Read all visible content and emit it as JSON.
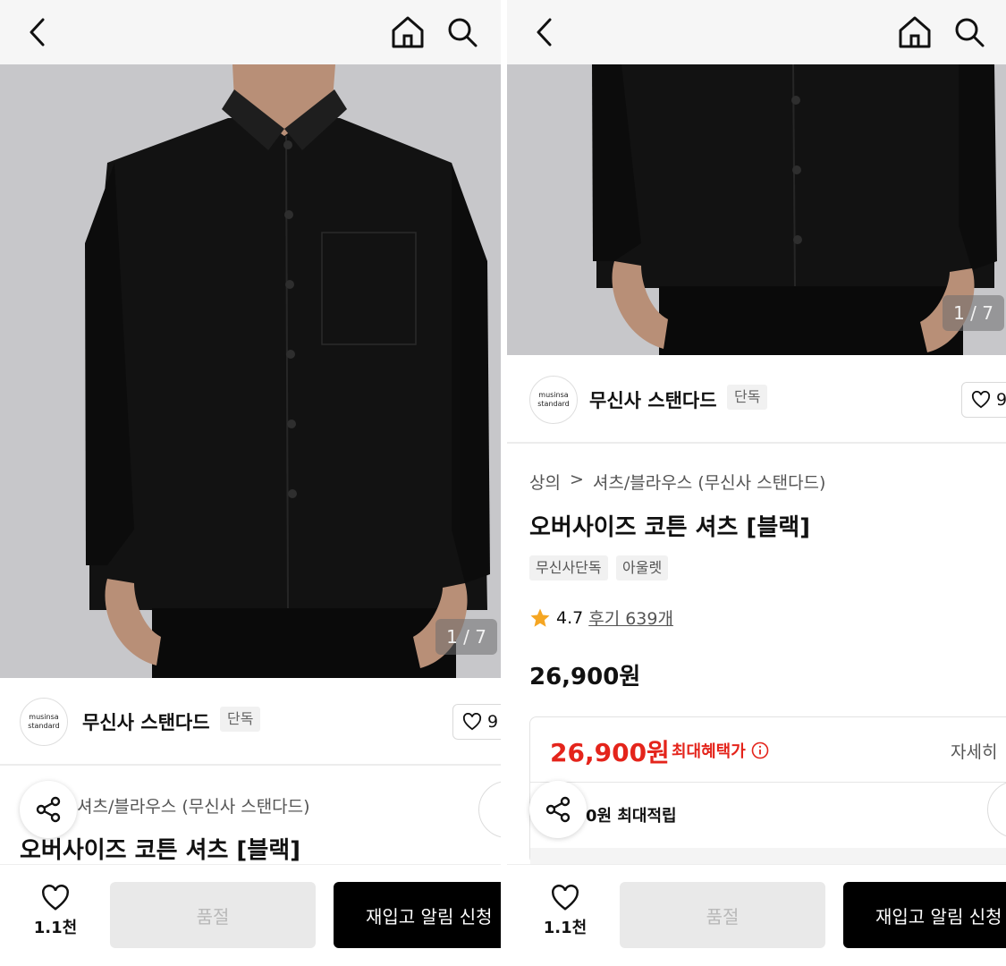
{
  "counter": "1 / 7",
  "brand": {
    "logo_line1": "musinsa",
    "logo_line2": "standard",
    "name": "무신사 스탠다드",
    "badge": "단독",
    "likes": "9"
  },
  "product": {
    "category_root": "상의",
    "category_sep": ">",
    "category_sub": "셔츠/블라우스 (무신사 스탠다드)",
    "category_sub_partial": "셔츠/블라우스 (무신사 스탠다드)",
    "title": "오버사이즈 코튼 셔츠 [블랙]",
    "tags": [
      "무신사단독",
      "아울렛"
    ],
    "rating": "4.7",
    "reviews": "후기 639개",
    "price": "26,900원"
  },
  "benefit": {
    "price": "26,900원",
    "label": "최대혜택가",
    "detail": "자세히",
    "points": "0원 최대적립"
  },
  "bottom_bar": {
    "wish_count": "1.1천",
    "soldout_label": "품절",
    "restock_label": "재입고 알림 신청"
  },
  "colors": {
    "accent_red": "#e4241b",
    "black": "#000000",
    "header_bg": "#f6f6f6"
  },
  "icons": [
    "back-icon",
    "home-icon",
    "search-icon",
    "heart-icon",
    "share-icon",
    "star-icon",
    "info-icon"
  ]
}
